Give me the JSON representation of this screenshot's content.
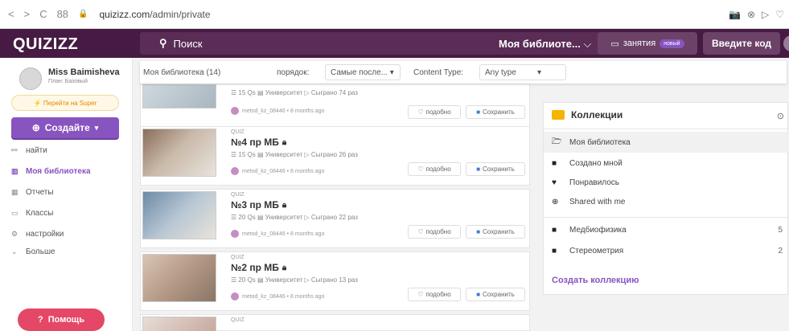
{
  "browser": {
    "back": "<",
    "forward": ">",
    "reload": "C",
    "grid": "88",
    "lock": "🔒",
    "host": "quizizz.com",
    "path": "/admin/private",
    "icons": [
      "📷",
      "⊗",
      "▷",
      "♡"
    ]
  },
  "topnav": {
    "logo": "QUIZIZZ",
    "search_icon": "🔍",
    "search_label": "Поиск",
    "library_select": "Моя библиоте...",
    "lessons_label": "занятия",
    "lessons_badge": "новый",
    "enter_code": "Введите код"
  },
  "sidebar": {
    "user_name": "Miss Baimisheva",
    "user_plan": "План: Базовый",
    "super_label": "Перейти на Super",
    "create_label": "Создайте",
    "items": [
      {
        "icon": "⚯",
        "label": "найти"
      },
      {
        "icon": "▥",
        "label": "Моя библиотека"
      },
      {
        "icon": "▦",
        "label": "Отчеты"
      },
      {
        "icon": "▭",
        "label": "Классы"
      },
      {
        "icon": "⚙",
        "label": "настройки"
      },
      {
        "icon": "⌄",
        "label": "Больше"
      }
    ],
    "help_label": "Помощь"
  },
  "filter": {
    "library": "Моя библиотека (14)",
    "sort_label": "порядок:",
    "sort_value": "Самые после...",
    "ct_label": "Content Type:",
    "ct_value": "Any type"
  },
  "quizzes": [
    {
      "type": "",
      "title": "",
      "meta": "15 Qs  ▤ Университет  ▷ Сыграно 74 раз",
      "author": "metod_kz_08446 • 8 months ago",
      "like": "подобно",
      "save": "Сохранить"
    },
    {
      "type": "QUIZ",
      "title": "№4 пр МБ",
      "meta": "15 Qs  ▤ Университет  ▷ Сыграно 26 раз",
      "author": "metod_kz_08446 • 8 months ago",
      "like": "подобно",
      "save": "Сохранить"
    },
    {
      "type": "QUIZ",
      "title": "№3 пр МБ",
      "meta": "20 Qs  ▤ Университет  ▷ Сыграно 22 раз",
      "author": "metod_kz_08446 • 8 months ago",
      "like": "подобно",
      "save": "Сохранить"
    },
    {
      "type": "QUIZ",
      "title": "№2 пр МБ",
      "meta": "20 Qs  ▤ Университет  ▷ Сыграно 13 раз",
      "author": "metod_kz_08446 • 8 months ago",
      "like": "подобно",
      "save": "Сохранить"
    },
    {
      "type": "QUIZ",
      "title": "",
      "meta": "",
      "author": "",
      "like": "",
      "save": ""
    }
  ],
  "collections": {
    "title": "Коллекции",
    "items": [
      {
        "icon": "🗁",
        "label": "Моя библиотека",
        "count": ""
      },
      {
        "icon": "■",
        "label": "Создано мной",
        "count": ""
      },
      {
        "icon": "♥",
        "label": "Понравилось",
        "count": ""
      },
      {
        "icon": "⊕",
        "label": "Shared with me",
        "count": ""
      },
      {
        "icon": "■",
        "label": "Медбиофизика",
        "count": "5"
      },
      {
        "icon": "■",
        "label": "Стереометрия",
        "count": "2"
      }
    ],
    "create_label": "Создать коллекцию"
  }
}
